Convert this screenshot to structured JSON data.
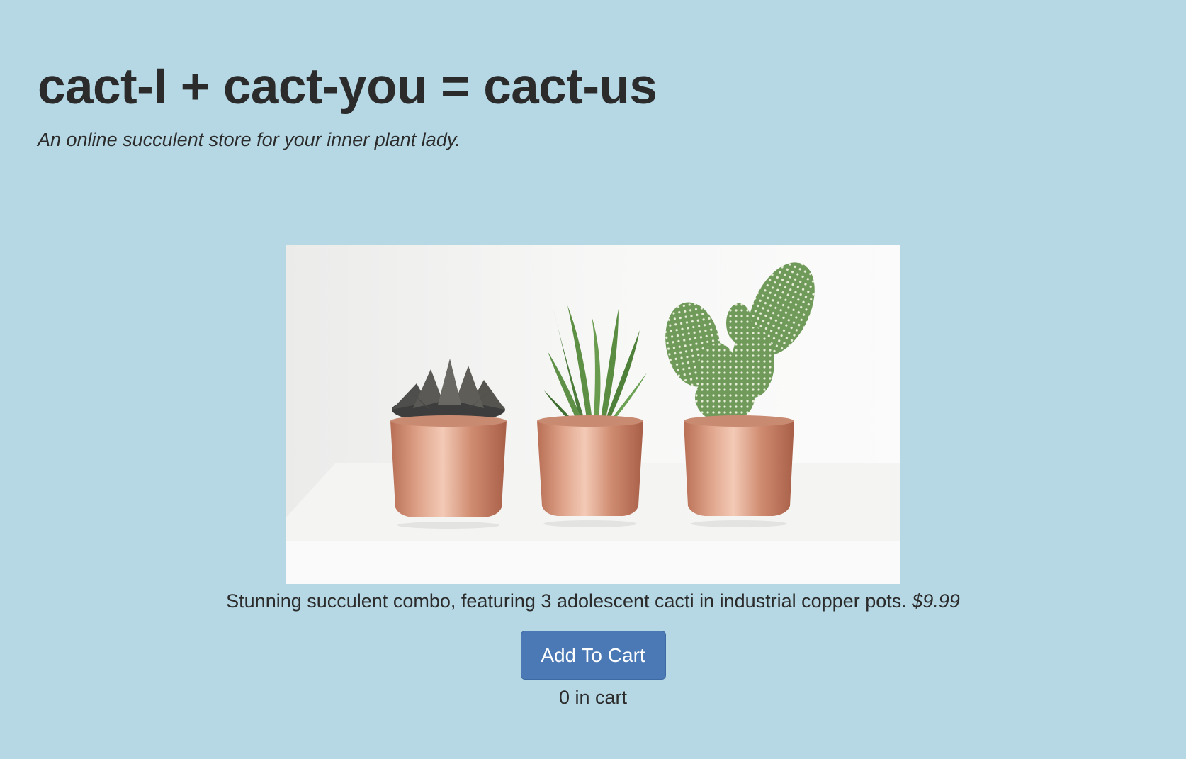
{
  "header": {
    "title": "cact-I + cact-you = cact-us",
    "tagline": "An online succulent store for your inner plant lady."
  },
  "product": {
    "image_icon": "three-succulents-in-copper-pots",
    "description": "Stunning succulent combo, featuring 3 adolescent cacti in industrial copper pots.",
    "price": "$9.99",
    "add_button_label": "Add To Cart",
    "cart_count": "0 in cart"
  },
  "colors": {
    "background": "#b6d8e4",
    "button": "#4a79b5",
    "text": "#2b2b2b",
    "copper": "#d4927a"
  }
}
